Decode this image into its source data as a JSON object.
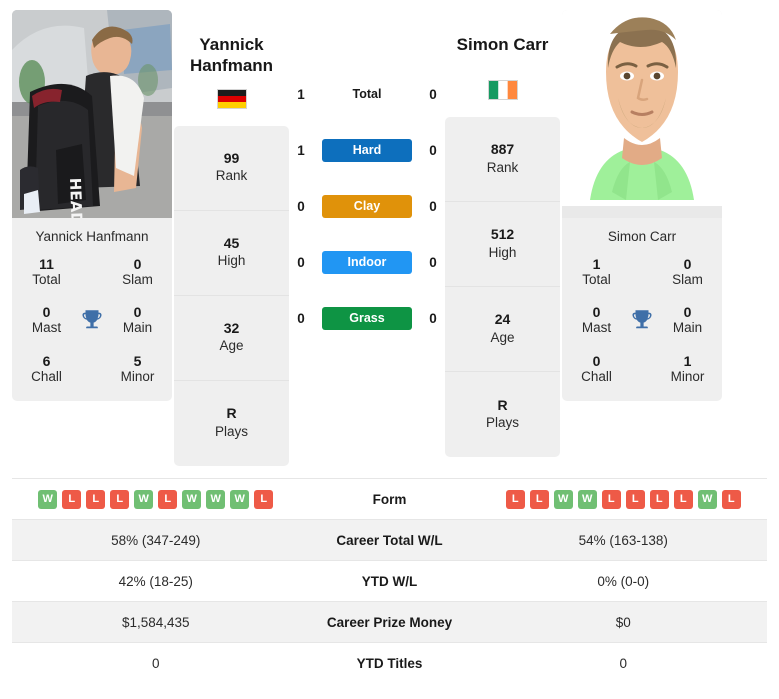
{
  "players": {
    "left": {
      "name": "Yannick Hanfmann",
      "name_line1": "Yannick",
      "name_line2": "Hanfmann",
      "country": "Germany",
      "flag": "de-flag",
      "photo_alt": "yannick-hanfmann-photo",
      "titles": {
        "total": "11",
        "total_label": "Total",
        "slam": "0",
        "slam_label": "Slam",
        "mast": "0",
        "mast_label": "Mast",
        "main": "0",
        "main_label": "Main",
        "chall": "6",
        "chall_label": "Chall",
        "minor": "5",
        "minor_label": "Minor"
      },
      "stats": [
        {
          "value": "99",
          "label": "Rank"
        },
        {
          "value": "45",
          "label": "High"
        },
        {
          "value": "32",
          "label": "Age"
        },
        {
          "value": "R",
          "label": "Plays"
        }
      ],
      "form": [
        "W",
        "L",
        "L",
        "L",
        "W",
        "L",
        "W",
        "W",
        "W",
        "L"
      ]
    },
    "right": {
      "name": "Simon Carr",
      "name_line1": "Simon Carr",
      "name_line2": "",
      "country": "Ireland",
      "flag": "ie-flag",
      "photo_alt": "simon-carr-photo",
      "titles": {
        "total": "1",
        "total_label": "Total",
        "slam": "0",
        "slam_label": "Slam",
        "mast": "0",
        "mast_label": "Mast",
        "main": "0",
        "main_label": "Main",
        "chall": "0",
        "chall_label": "Chall",
        "minor": "1",
        "minor_label": "Minor"
      },
      "stats": [
        {
          "value": "887",
          "label": "Rank"
        },
        {
          "value": "512",
          "label": "High"
        },
        {
          "value": "24",
          "label": "Age"
        },
        {
          "value": "R",
          "label": "Plays"
        }
      ],
      "form": [
        "L",
        "L",
        "W",
        "W",
        "L",
        "L",
        "L",
        "L",
        "W",
        "L"
      ]
    }
  },
  "h2h": [
    {
      "label": "Total",
      "left": "1",
      "right": "0",
      "badge": false,
      "color": ""
    },
    {
      "label": "Hard",
      "left": "1",
      "right": "0",
      "badge": true,
      "color": "#0d6fbd"
    },
    {
      "label": "Clay",
      "left": "0",
      "right": "0",
      "badge": true,
      "color": "#e0920a"
    },
    {
      "label": "Indoor",
      "left": "0",
      "right": "0",
      "badge": true,
      "color": "#2196f3"
    },
    {
      "label": "Grass",
      "left": "0",
      "right": "0",
      "badge": true,
      "color": "#0e9444"
    }
  ],
  "table": [
    {
      "label": "Form",
      "left": "",
      "right": "",
      "type": "form"
    },
    {
      "label": "Career Total W/L",
      "left": "58% (347-249)",
      "right": "54% (163-138)",
      "type": "text"
    },
    {
      "label": "YTD W/L",
      "left": "42% (18-25)",
      "right": "0% (0-0)",
      "type": "text"
    },
    {
      "label": "Career Prize Money",
      "left": "$1,584,435",
      "right": "$0",
      "type": "text"
    },
    {
      "label": "YTD Titles",
      "left": "0",
      "right": "0",
      "type": "text"
    }
  ],
  "colors": {
    "win": "#70bf73",
    "loss": "#ee5a47",
    "trophy": "#3f6fa8",
    "card_bg": "#efefef",
    "row_alt": "#f2f2f2"
  }
}
